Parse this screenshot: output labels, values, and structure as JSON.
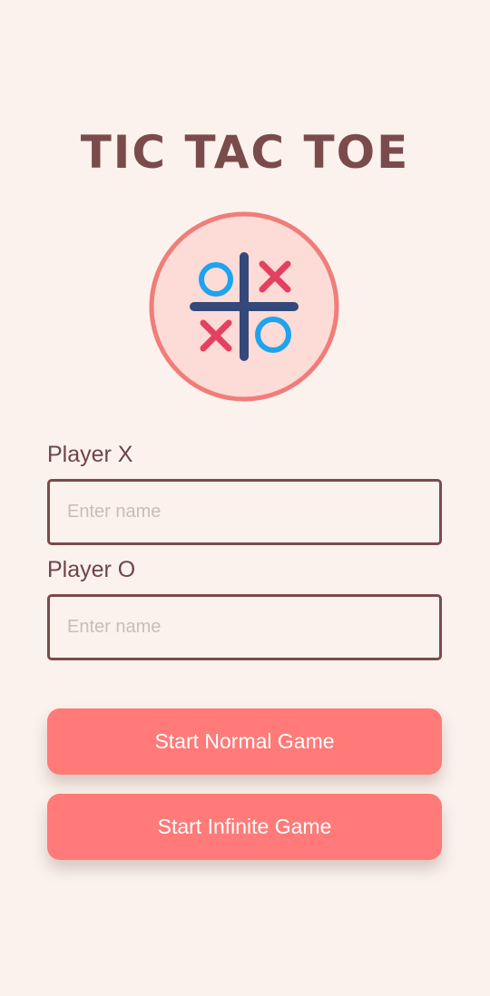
{
  "app": {
    "title": "TIC TAC TOE"
  },
  "logo": {
    "icon": "tic-tac-toe-logo-icon",
    "circle_fill": "#fddbd6",
    "circle_stroke": "#f07d7a",
    "grid_color": "#34487a",
    "o_color": "#1ea3ef",
    "x_color": "#e4405f"
  },
  "form": {
    "player_x": {
      "label": "Player X",
      "placeholder": "Enter name",
      "value": ""
    },
    "player_o": {
      "label": "Player O",
      "placeholder": "Enter name",
      "value": ""
    }
  },
  "actions": {
    "normal_label": "Start Normal Game",
    "infinite_label": "Start Infinite Game"
  },
  "colors": {
    "background": "#fbf2ed",
    "accent": "#ff7a78",
    "text": "#7b4b4b"
  }
}
